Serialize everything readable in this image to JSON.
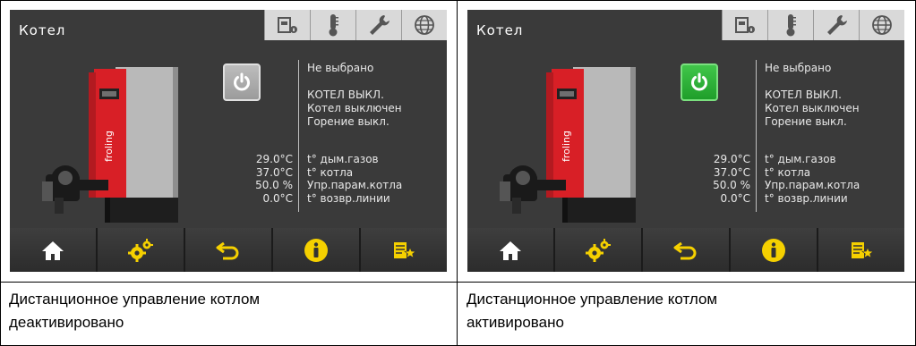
{
  "panels": [
    {
      "screen": {
        "title": "Котел",
        "tabs": [
          {
            "icon": "boiler-info-icon"
          },
          {
            "icon": "thermometer-icon"
          },
          {
            "icon": "wrench-icon"
          },
          {
            "icon": "globe-icon"
          }
        ],
        "power_state": "off",
        "power_color": "#a9a9a9",
        "boiler_brand": "froling",
        "status_lines": [
          "Не выбрано",
          "",
          "КОТЕЛ ВЫКЛ.",
          "Котел выключен",
          "Горение выкл."
        ],
        "measurements": [
          {
            "value": "29.0°C",
            "label": "t° дым.газов"
          },
          {
            "value": "37.0°C",
            "label": "t° котла"
          },
          {
            "value": "50.0 %",
            "label": "Упр.парам.котла"
          },
          {
            "value": "0.0°C",
            "label": "t° возвр.линии"
          }
        ],
        "nav": [
          {
            "icon": "home-icon"
          },
          {
            "icon": "gears-icon"
          },
          {
            "icon": "back-arrow-icon"
          },
          {
            "icon": "info-icon"
          },
          {
            "icon": "favorites-list-icon"
          }
        ]
      },
      "caption": "Дистанционное управление котлом\nдеактивировано"
    },
    {
      "screen": {
        "title": "Котел",
        "tabs": [
          {
            "icon": "boiler-info-icon"
          },
          {
            "icon": "thermometer-icon"
          },
          {
            "icon": "wrench-icon"
          },
          {
            "icon": "globe-icon"
          }
        ],
        "power_state": "on",
        "power_color": "#2db83a",
        "boiler_brand": "froling",
        "status_lines": [
          "Не выбрано",
          "",
          "КОТЕЛ ВЫКЛ.",
          "Котел выключен",
          "Горение выкл."
        ],
        "measurements": [
          {
            "value": "29.0°C",
            "label": "t° дым.газов"
          },
          {
            "value": "37.0°C",
            "label": "t° котла"
          },
          {
            "value": "50.0 %",
            "label": "Упр.парам.котла"
          },
          {
            "value": "0.0°C",
            "label": "t° возвр.линии"
          }
        ],
        "nav": [
          {
            "icon": "home-icon"
          },
          {
            "icon": "gears-icon"
          },
          {
            "icon": "back-arrow-icon"
          },
          {
            "icon": "info-icon"
          },
          {
            "icon": "favorites-list-icon"
          }
        ]
      },
      "caption": "Дистанционное управление котлом\nактивировано"
    }
  ],
  "colors": {
    "screen_bg": "#3a3a3a",
    "text": "#e8e8e8",
    "accent_yellow": "#f5d000"
  }
}
